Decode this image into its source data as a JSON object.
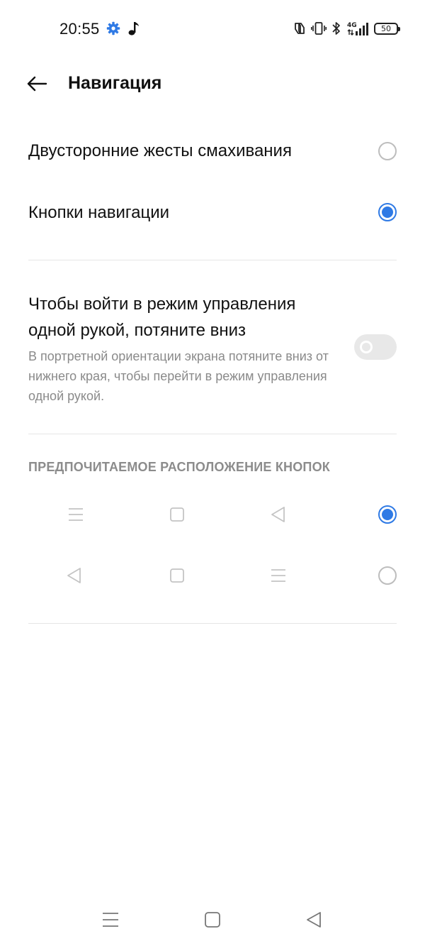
{
  "status_bar": {
    "time": "20:55",
    "icons": [
      "gear-icon",
      "music-note-icon",
      "nfc-icon",
      "vibrate-icon",
      "bluetooth-icon",
      "signal-4g-icon"
    ],
    "network_label": "4G",
    "battery_level": "50"
  },
  "header": {
    "title": "Навигация",
    "back_icon": "arrow-left-icon"
  },
  "navigation_modes": [
    {
      "label": "Двусторонние жесты смахивания",
      "selected": false
    },
    {
      "label": "Кнопки навигации",
      "selected": true
    }
  ],
  "one_hand_mode": {
    "title": "Чтобы войти в режим управления одной рукой, потяните вниз",
    "description": "В портретной ориентации экрана потяните вниз от нижнего края, чтобы перейти в режим управления одной рукой.",
    "enabled": false
  },
  "button_layout": {
    "header": "ПРЕДПОЧИТАЕМОЕ РАСПОЛОЖЕНИЕ КНОПОК",
    "options": [
      {
        "icons": [
          "menu-icon",
          "home-square-icon",
          "back-triangle-icon"
        ],
        "selected": true
      },
      {
        "icons": [
          "back-triangle-icon",
          "home-square-icon",
          "menu-icon"
        ],
        "selected": false
      }
    ]
  },
  "system_nav": {
    "icons": [
      "menu-icon",
      "home-square-icon",
      "back-triangle-icon"
    ]
  },
  "colors": {
    "accent": "#2f7ae5",
    "text_primary": "#111111",
    "text_secondary": "#8a8a8a",
    "divider": "#e6e6e6"
  }
}
